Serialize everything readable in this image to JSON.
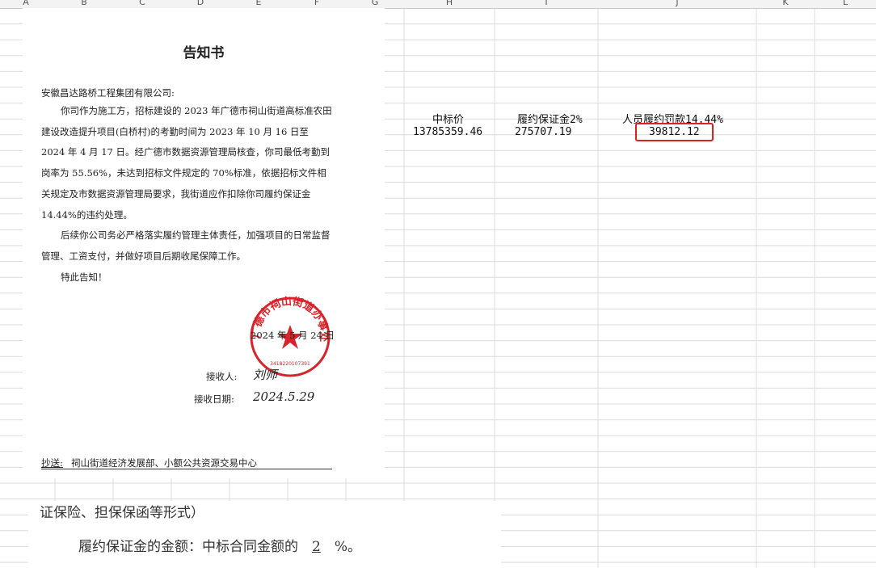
{
  "column_headers": [
    "A",
    "B",
    "C",
    "D",
    "E",
    "F",
    "G",
    "H",
    "I",
    "J",
    "K",
    "L"
  ],
  "table": {
    "headers": [
      "中标价",
      "履约保证金2%",
      "人员履约罚款14.44%"
    ],
    "values": [
      "13785359.46",
      "275707.19",
      "39812.12"
    ],
    "highlight_color": "#e02020"
  },
  "notice": {
    "title": "告知书",
    "addressee": "安徽昌达路桥工程集团有限公司:",
    "paragraphs": [
      "你司作为施工方，招标建设的 2023 年广德市祠山街道高标准农田建设改造提升项目(白桥村)的考勤时间为 2023 年 10 月 16 日至 2024 年 4 月 17 日。经广德市数据资源管理局核查，你司最低考勤到岗率为 55.56%，未达到招标文件规定的 70%标准，依据招标文件相关规定及市数据资源管理局要求，我街道应作扣除你司履约保证金 14.44%的违约处理。",
      "后续你公司务必严格落实履约管理主体责任，加强项目的日常监督管理、工资支付，并做好项目后期收尾保障工作。",
      "特此告知！"
    ],
    "date": "2024 年 5 月 24 日",
    "seal_text": "广德市祠山街道办事处",
    "seal_code": "3418220107391",
    "receiver_label": "接收人:",
    "receiver_signature": "刘师",
    "receive_date_label": "接收日期:",
    "receive_date_value": "2024.5.29",
    "cc_label": "抄送:",
    "cc_text": "祠山街道经济发展部、小额公共资源交易中心",
    "seal_color": "#d8232a"
  },
  "clause": {
    "line1": "证保险、担保保函等形式）",
    "line2_prefix": "履约保证金的金额：中标合同金额的",
    "line2_value": "2",
    "line2_suffix": "%。"
  }
}
